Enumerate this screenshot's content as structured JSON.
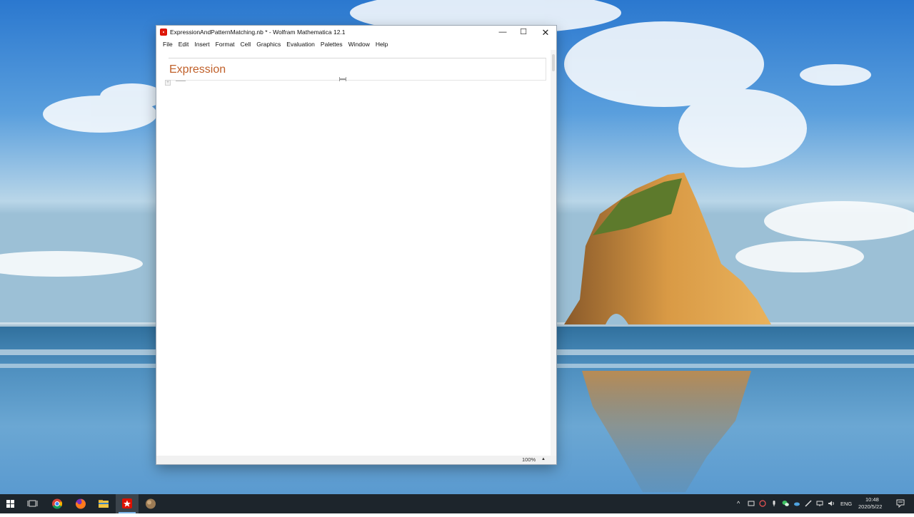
{
  "window": {
    "title": "ExpressionAndPatternMatching.nb * - Wolfram Mathematica 12.1",
    "minimize_glyph": "—",
    "maximize_glyph": "☐",
    "close_glyph": "✕"
  },
  "menu": {
    "items": [
      "File",
      "Edit",
      "Insert",
      "Format",
      "Cell",
      "Graphics",
      "Evaluation",
      "Palettes",
      "Window",
      "Help"
    ]
  },
  "notebook": {
    "section_title": "Expression",
    "bracket_marker": "+"
  },
  "statusbar": {
    "zoom": "100%",
    "zoom_arrow": "▲"
  },
  "taskbar": {
    "apps": [
      "windows-start-icon",
      "task-view-icon",
      "chrome-icon",
      "firefox-icon",
      "file-explorer-icon",
      "mathematica-icon",
      "app-icon"
    ],
    "language": "ENG",
    "time": "10:48",
    "date": "2020/5/22",
    "tray_chevron": "^"
  },
  "colors": {
    "section_title": "#c0602a",
    "taskbar": "#1d252c",
    "mathematica_red": "#dd1100"
  }
}
